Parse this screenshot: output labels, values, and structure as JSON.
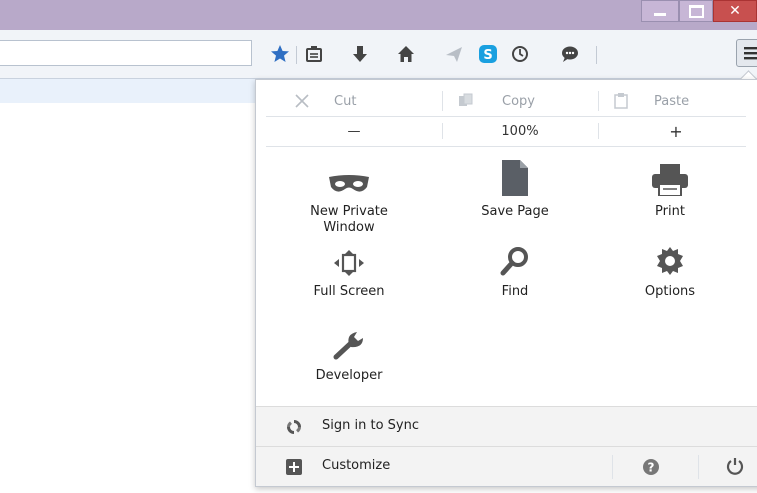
{
  "window": {
    "controls": {
      "minimize_icon": "minimize-icon",
      "maximize_icon": "maximize-icon",
      "close_icon": "close-icon",
      "close_glyph": "✕"
    }
  },
  "toolbar": {
    "icons": [
      "bookmark-star-icon",
      "reading-list-icon",
      "downloads-icon",
      "home-icon",
      "pocket-send-icon",
      "skype-icon",
      "history-clock-icon",
      "chat-icon",
      "hamburger-menu-icon"
    ],
    "accent": "#2f6fc3"
  },
  "panel": {
    "edit": {
      "cut": "Cut",
      "copy": "Copy",
      "paste": "Paste"
    },
    "zoom": {
      "out": "—",
      "level": "100%",
      "in": "+"
    },
    "items": [
      {
        "label": "New Private Window",
        "icon": "private-mask-icon"
      },
      {
        "label": "Save Page",
        "icon": "save-page-icon"
      },
      {
        "label": "Print",
        "icon": "printer-icon"
      },
      {
        "label": "Full Screen",
        "icon": "full-screen-icon"
      },
      {
        "label": "Find",
        "icon": "magnifier-icon"
      },
      {
        "label": "Options",
        "icon": "gear-icon"
      },
      {
        "label": "Developer",
        "icon": "wrench-icon"
      }
    ],
    "sync": {
      "label": "Sign in to Sync",
      "icon": "sync-icon"
    },
    "customize": {
      "label": "Customize",
      "icon": "customize-plus-icon",
      "help_icon": "help-icon",
      "quit_icon": "power-icon"
    }
  }
}
